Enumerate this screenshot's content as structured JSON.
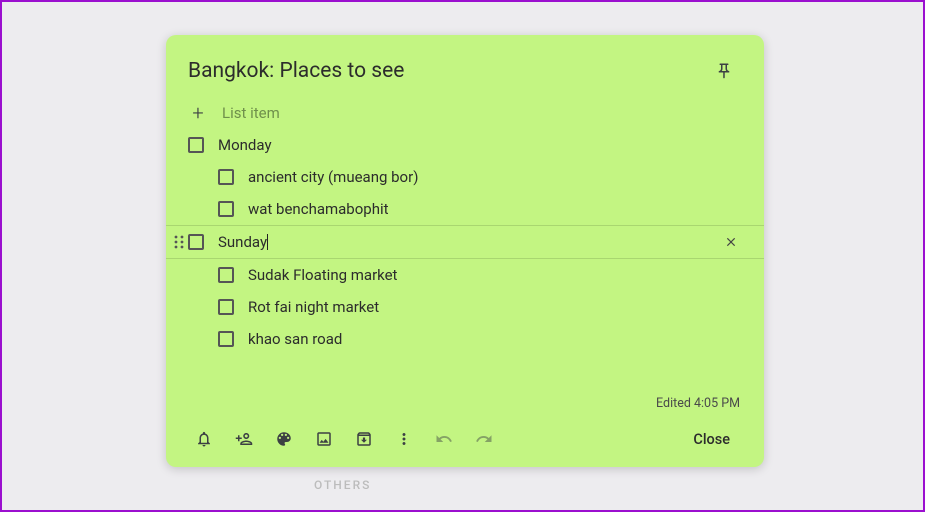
{
  "others_label": "OTHERS",
  "note": {
    "title": "Bangkok: Places to see",
    "new_item_placeholder": "List item",
    "items": [
      {
        "text": "Monday",
        "level": 0,
        "active": false
      },
      {
        "text": "ancient city (mueang bor)",
        "level": 1,
        "active": false
      },
      {
        "text": "wat benchamabophit",
        "level": 1,
        "active": false
      },
      {
        "text": "Sunday",
        "level": 0,
        "active": true
      },
      {
        "text": "Sudak Floating market",
        "level": 1,
        "active": false
      },
      {
        "text": "Rot fai night market",
        "level": 1,
        "active": false
      },
      {
        "text": "khao san road",
        "level": 1,
        "active": false
      }
    ],
    "edited": "Edited 4:05 PM",
    "close_label": "Close"
  }
}
